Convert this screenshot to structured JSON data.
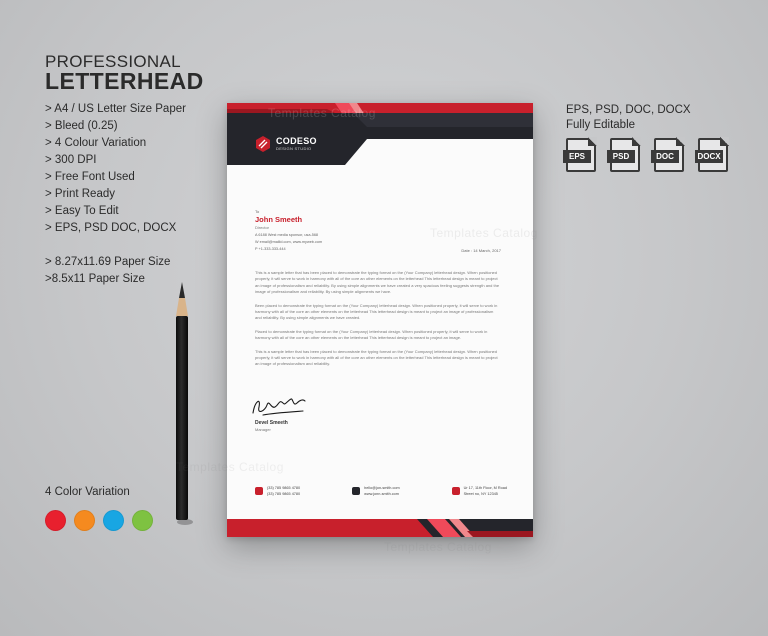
{
  "promo": {
    "title_small": "PROFESSIONAL",
    "title_large": "LETTERHEAD",
    "features": [
      "> A4 / US Letter Size Paper",
      "> Bleed (0.25)",
      "> 4 Colour Variation",
      "> 300 DPI",
      "> Free Font Used",
      "> Print Ready",
      "> Easy To Edit",
      "> EPS, PSD DOC, DOCX"
    ],
    "sizes": [
      "> 8.27x11.69 Paper Size",
      ">8.5x11 Paper Size"
    ],
    "color_variation_title": "4 Color Variation",
    "colors": [
      "#e8202e",
      "#f58a1f",
      "#18a6e3",
      "#7ec241"
    ]
  },
  "formats": {
    "line1": "EPS, PSD, DOC, DOCX",
    "line2": "Fully Editable",
    "icons": [
      {
        "label": "EPS",
        "icon": "eps-file-icon"
      },
      {
        "label": "PSD",
        "icon": "psd-file-icon"
      },
      {
        "label": "DOC",
        "icon": "doc-file-icon"
      },
      {
        "label": "DOCX",
        "icon": "docx-file-icon"
      }
    ]
  },
  "letterhead": {
    "brand": "CODESO",
    "brand_sub": "DESIGN STUDIO",
    "accent": "#c8202c",
    "dark": "#24252b",
    "to_label": "To",
    "recipient_name": "John Smeeth",
    "recipient_role": "Director",
    "address_line": "A   6188 West media sponsor, usa-568",
    "email_line": "W   email@mailid.com, www.myweb.com",
    "phone_line": "P   +1-333-333-444",
    "date": "Date : 14 March, 2017",
    "paragraphs": [
      "This is a sample letter that has been placed to demonstrate the typing format on the (Your Company) letterhead design. When positioned properly, it will serve to work in harmony with all of the core an other elements on the letterhead This letterhead design is meant to project an image of professionalism and reliability. By using simple alignments we have created a very spacious feeling suggests strength and the image of professionalism and reliability. By using simple alignments we have.",
      "Been placed to demonstrate the typing format on the (Your Company) letterhead design. When positioned properly, it will serve to work in harmony with all of the core an other elements on the letterhead This letterhead design is meant to project an image of professionalism and reliability. By using simple alignments we have created.",
      "Placed to demonstrate the typing format on the (Your Company) letterhead design. When positioned properly, it will serve to work in harmony with all of the core an other elements on the letterhead This letterhead design is meant to project an image.",
      "This is a sample letter that has been placed to demonstrate the typing format on the (Your Company) letterhead design. When positioned properly, it will serve to work in harmony with all of the core an other elements on the letterhead This letterhead design is meant to project an image of professionalism and reliability."
    ],
    "signer_name": "Devel Smeeth",
    "signer_role": "Manager",
    "footer": {
      "phone_1": "(33) 785 9865 4780",
      "phone_2": "(33) 785 9865 4780",
      "email_1": "hello@jon-smith.com",
      "email_2": "www.jonn-smith.com",
      "address_1": "Ur 17, 11th Floor, M Road",
      "address_2": "Street no, NY 12345"
    }
  },
  "watermarks": [
    "Templates Catalog",
    "Templates Catalog",
    "Templates Catalog",
    "Templates Catalog"
  ]
}
